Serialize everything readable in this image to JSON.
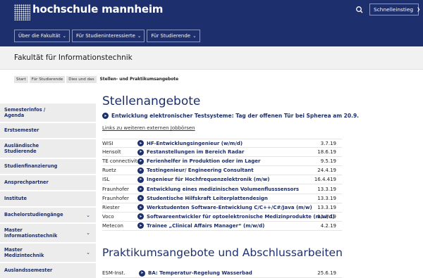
{
  "header": {
    "logo_text": "hochschule mannheim",
    "quick_access": "Schnelleinstieg",
    "nav": [
      "Über die Fakultät",
      "Für Studieninteressierte",
      "Für Studierende"
    ]
  },
  "faculty_title": "Fakultät für Informationstechnik",
  "breadcrumb": {
    "items": [
      "Start",
      "Für Studierende",
      "Dies und das"
    ],
    "current": "Stellen- und Praktikumsangebote"
  },
  "sidebar": {
    "items": [
      {
        "label": "Semesterinfos / Agenda",
        "chevron": false
      },
      {
        "label": "Erstsemester",
        "chevron": false
      },
      {
        "label": "Ausländische Studierende",
        "chevron": false
      },
      {
        "label": "Studienfinanzierung",
        "chevron": false
      },
      {
        "label": "Ansprechpartner",
        "chevron": false
      },
      {
        "label": "Institute",
        "chevron": false
      },
      {
        "label": "Bachelorstudiengänge",
        "chevron": true
      },
      {
        "label": "Master Informationstechnik",
        "chevron": true
      },
      {
        "label": "Master Medizintechnik",
        "chevron": true
      },
      {
        "label": "Auslandssemester",
        "chevron": false
      }
    ]
  },
  "main": {
    "heading": "Stellenangebote",
    "featured": "Entwicklung elektronischer Testsysteme: Tag der offenen Tür bei Spherea am 20.9.",
    "external_link": "Links zu weiteren externen Jobbörsen",
    "jobs": [
      {
        "company": "WISI",
        "title": "HF-Entwicklungsingenieur (w/m/d)",
        "date": "3.7.19"
      },
      {
        "company": "Hensolt",
        "title": "Festanstellungen im Bereich Radar",
        "date": "18.6.19"
      },
      {
        "company": "TE connectivity",
        "title": "Ferienhelfer in Produktion oder im Lager",
        "date": "9.5.19"
      },
      {
        "company": "Ruetz",
        "title": "Testingenieur/ Engineering Consultant",
        "date": "24.4.19"
      },
      {
        "company": "ISL",
        "title": "Ingenieur für Hochfrequenzelektronik (m/w)",
        "date": "16.4.419"
      },
      {
        "company": "Fraunhofer",
        "title": "Entwicklung eines medizinischen Volumenflusssensors",
        "date": "13.3.19"
      },
      {
        "company": "Fraunhofer",
        "title": "Studentische Hilfskraft Leiterplattendesign",
        "date": "13.3.19"
      },
      {
        "company": "Riester",
        "title": "Werkstudenten Software-Entwicklung C/C++/C#/Java (m/w)",
        "date": "13.3.19"
      },
      {
        "company": "Voco",
        "title": "Softwareentwickler für optoelektronische Medizinprodukte (m/w/d)",
        "date": "11.3.19"
      },
      {
        "company": "Metecon",
        "title": "Trainee „Clinical Affairs Manager“ (m/w/d)",
        "date": "4.2.19"
      }
    ],
    "heading2": "Praktikumsangebote und Abschlussarbeiten",
    "internships": [
      {
        "company": "ESM-Inst.",
        "title": "BA: Temperatur-Regelung Wasserbad",
        "date": "25.6.19"
      }
    ]
  }
}
